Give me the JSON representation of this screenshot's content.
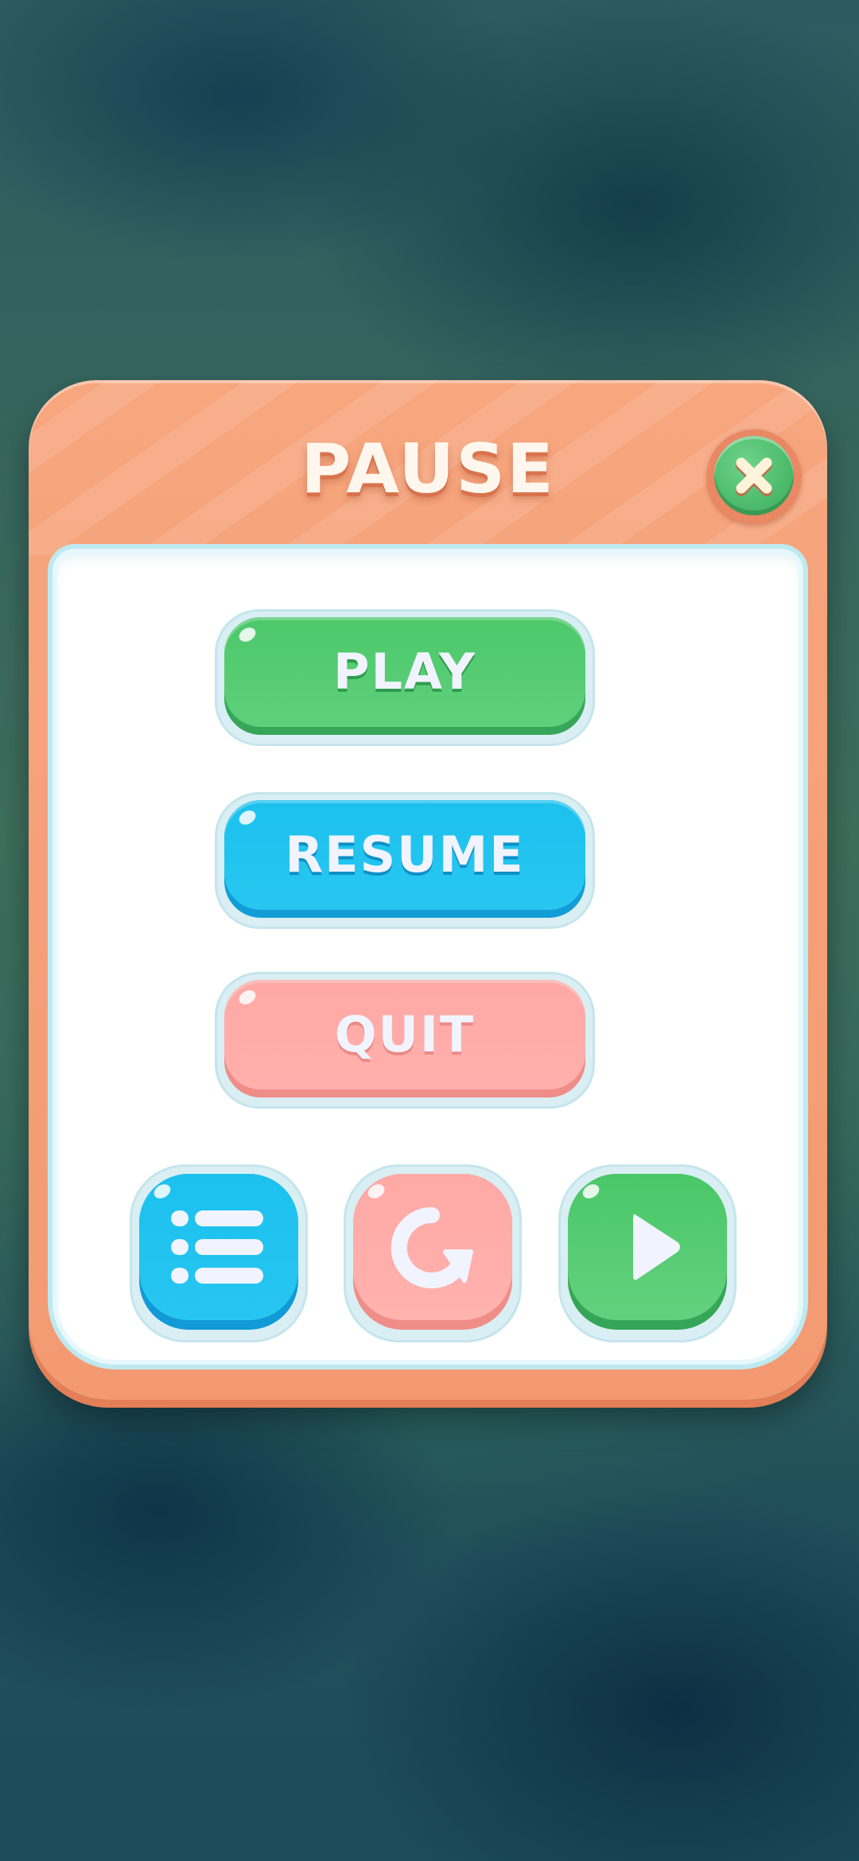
{
  "dialog": {
    "title": "PAUSE",
    "close_icon": "close-icon"
  },
  "buttons": {
    "play_label": "PLAY",
    "resume_label": "RESUME",
    "quit_label": "QUIT"
  },
  "icon_buttons": [
    {
      "name": "menu-list-button",
      "icon": "list-icon",
      "color": "#1cc1ee"
    },
    {
      "name": "restart-button",
      "icon": "restart-icon",
      "color": "#ffa9a6"
    },
    {
      "name": "next-button",
      "icon": "play-icon",
      "color": "#4ac768"
    }
  ],
  "colors": {
    "frame": "#f7a67e",
    "green": "#4cc86a",
    "blue": "#1cc1ee",
    "pink": "#ffa8a5",
    "text": "#f1f4ff"
  }
}
